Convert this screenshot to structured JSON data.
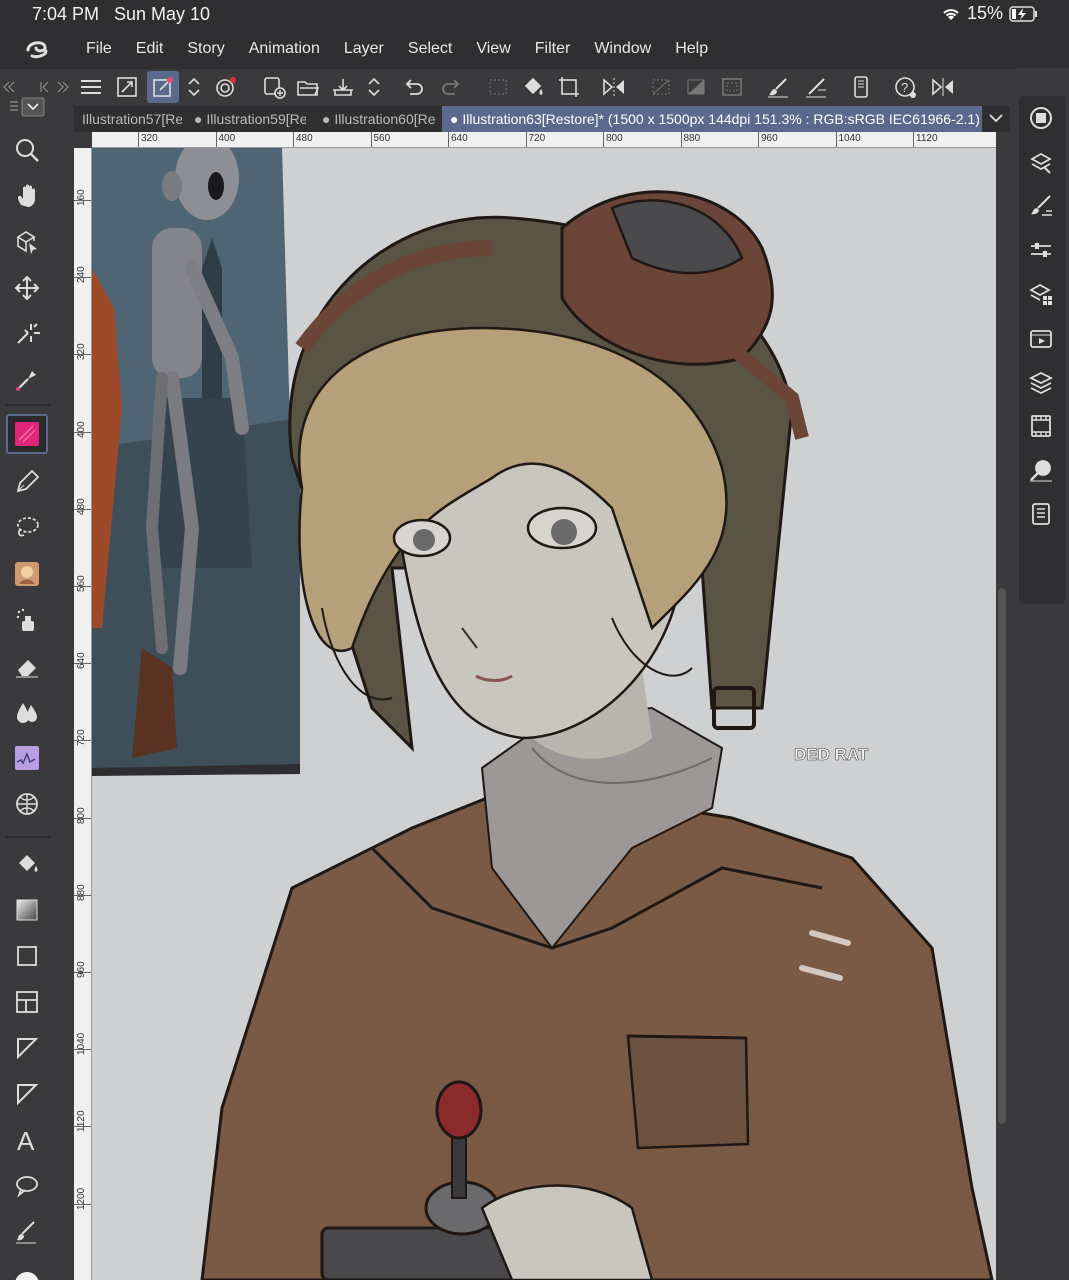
{
  "status": {
    "time": "7:04 PM",
    "date": "Sun May 10",
    "battery": "15%"
  },
  "menu": {
    "items": [
      "File",
      "Edit",
      "Story",
      "Animation",
      "Layer",
      "Select",
      "View",
      "Filter",
      "Window",
      "Help"
    ]
  },
  "tabs": [
    {
      "label": "Illustration57[Re"
    },
    {
      "label": "Illustration59[Re"
    },
    {
      "label": "Illustration60[Re"
    },
    {
      "label": "Illustration63[Restore]* (1500 x 1500px 144dpi 151.3% : RGB:sRGB IEC61966-2.1)"
    }
  ],
  "ruler": {
    "h_labels": [
      "320",
      "400",
      "480",
      "560",
      "640",
      "720",
      "800",
      "880",
      "960",
      "1040",
      "1120"
    ],
    "v_labels": [
      "160",
      "240",
      "320",
      "400",
      "480",
      "560",
      "640",
      "720",
      "800",
      "880",
      "960",
      "1040",
      "1120",
      "1200"
    ]
  },
  "canvas": {
    "signature": "DED RAT",
    "bg_color": "#cfd0d2",
    "jacket_color": "#7a5a45",
    "hair_color": "#b6a07a",
    "helmet_color": "#5a5444",
    "goggle_color": "#6a4538",
    "skin_color": "#c9c6c0",
    "sweater_color": "#9c9898"
  },
  "colors": {
    "accent": "#5b6a8c",
    "main_color_swatch": "#e0267a"
  }
}
